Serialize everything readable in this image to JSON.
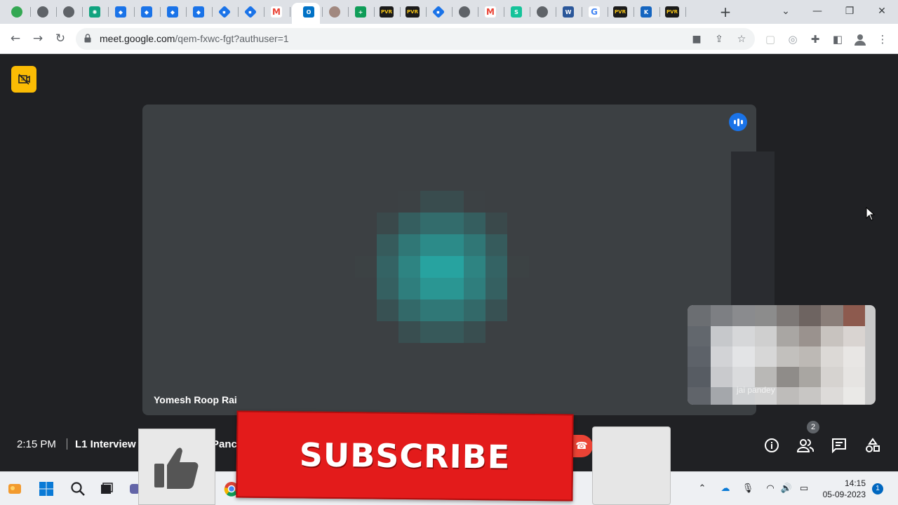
{
  "browser": {
    "tab_icons": [
      "chrome-icon",
      "globe-icon",
      "edge-icon",
      "chatgpt-icon",
      "shield-icon",
      "shield-icon",
      "shield-icon",
      "shield-icon",
      "jira-icon",
      "jira-icon",
      "gmail-icon",
      "meet-icon",
      "outlook-icon",
      "avatar-icon",
      "sheets-icon",
      "pvr-icon",
      "pvr-icon",
      "jira-icon",
      "globe-icon",
      "gmail-icon",
      "grammarly-icon",
      "globe-icon",
      "word-icon",
      "google-icon",
      "pvr-icon",
      "k-icon",
      "pvr-icon"
    ],
    "pvr_label": "PVR",
    "url_host": "meet.google.com",
    "url_path": "/qem-fxwc-fgt?authuser=1"
  },
  "meet": {
    "participant_name": "Yomesh Roop Rai",
    "self_caption": "jai pandey",
    "time": "2:15 PM",
    "meeting_title": "L1 Interview",
    "meeting_title_suffix": "Panc",
    "people_count": "2",
    "accent_color": "#1a73e8"
  },
  "overlay": {
    "subscribe_label": "SUBSCRIBE",
    "subscribe_color": "#e31b1b"
  },
  "taskbar": {
    "clock_time": "14:15",
    "clock_date": "05-09-2023",
    "notification_count": "1"
  }
}
